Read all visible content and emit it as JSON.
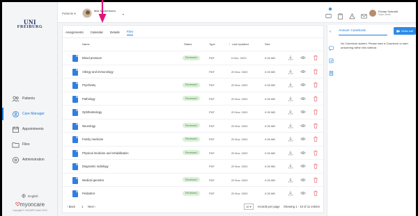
{
  "logo": {
    "line1": "UNI",
    "line2": "FREIBURG"
  },
  "sidebar": {
    "items": [
      {
        "label": "Patients",
        "icon": "patients-icon"
      },
      {
        "label": "Care Manager",
        "icon": "care-manager-icon",
        "active": true
      },
      {
        "label": "Appointments",
        "icon": "calendar-icon"
      },
      {
        "label": "Files",
        "icon": "folder-icon"
      },
      {
        "label": "Administration",
        "icon": "gear-icon"
      }
    ],
    "language": "English",
    "brand_a": "my",
    "brand_b": "oncare",
    "copyright": "Copyright © ONCARE GmbH 2023"
  },
  "topbar": {
    "patients_label": "Patients",
    "patient_name_line1": "Max Mustermann",
    "patient_name_line2": "",
    "notification_count": "2",
    "user_name": "Florian Schmidt",
    "user_role": "Super Admin"
  },
  "tabs": [
    "Assignments",
    "Calendar",
    "Details",
    "Files"
  ],
  "active_tab": "Files",
  "table": {
    "headers": {
      "name": "Name",
      "status": "Status",
      "type": "Type",
      "updated": "Last Updated",
      "size": "Size"
    },
    "rows": [
      {
        "name": "Blood pressure",
        "status": "Reviewed",
        "type": "PDF",
        "date": "5 Dec. 2023",
        "size": "0.05 MB"
      },
      {
        "name": "Allergy and immunology",
        "status": "",
        "type": "PDF",
        "date": "20 Nov. 2020",
        "size": "0.05 MB"
      },
      {
        "name": "Psychiatry",
        "status": "Reviewed",
        "type": "PDF",
        "date": "20 Nov. 2020",
        "size": "0.05 MB"
      },
      {
        "name": "Pathology",
        "status": "Reviewed",
        "type": "PDF",
        "date": "20 Nov. 2020",
        "size": "0.05 MB"
      },
      {
        "name": "Ophthalmology",
        "status": "",
        "type": "PDF",
        "date": "20 Nov. 2020",
        "size": "0.05 MB"
      },
      {
        "name": "Neurology",
        "status": "Reviewed",
        "type": "PDF",
        "date": "20 Nov. 2020",
        "size": "0.05 MB"
      },
      {
        "name": "Family medicine",
        "status": "Reviewed",
        "type": "PDF",
        "date": "20 Nov. 2020",
        "size": "0.05 MB"
      },
      {
        "name": "Physical medicine and rehabilitation",
        "status": "Reviewed",
        "type": "PDF",
        "date": "20 Nov. 2020",
        "size": "0.05 MB"
      },
      {
        "name": "Diagnostic radiology",
        "status": "",
        "type": "PDF",
        "date": "20 Nov. 2020",
        "size": "0.05 MB"
      },
      {
        "name": "Medical genetics",
        "status": "Reviewed",
        "type": "PDF",
        "date": "20 Nov. 2020",
        "size": "0.05 MB"
      },
      {
        "name": "Pediatrics",
        "status": "Reviewed",
        "type": "PDF",
        "date": "20 Nov. 2020",
        "size": "0.05 MB"
      }
    ]
  },
  "pagination": {
    "back": "Back",
    "page": "1",
    "next": "Next",
    "per_page": "10",
    "per_page_label": "records per page",
    "showing": "Showing 1 - 10 of 11 entries"
  },
  "right_panel": {
    "tab": "Answer Casebook",
    "button": "Video call",
    "message": "No Casebook started. Please start a Casebook to start answering within this sidebar."
  },
  "colors": {
    "accent": "#1f7bd8",
    "reviewed_bg": "#dcefd8",
    "reviewed_text": "#3c8f46",
    "delete": "#e0525a",
    "arrow": "#e0147a"
  }
}
